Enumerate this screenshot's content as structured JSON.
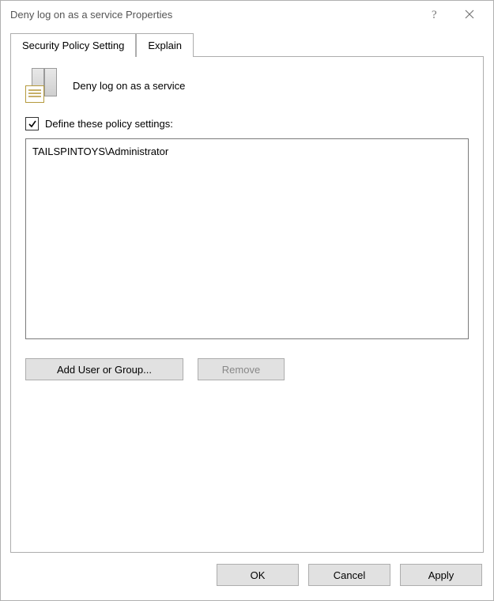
{
  "titlebar": {
    "title": "Deny log on as a service Properties"
  },
  "tabs": {
    "security": "Security Policy Setting",
    "explain": "Explain"
  },
  "panel": {
    "heading": "Deny log on as a service",
    "define_label": "Define these policy settings:",
    "define_checked": true,
    "items": [
      "TAILSPINTOYS\\Administrator"
    ],
    "add_button": "Add User or Group...",
    "remove_button": "Remove"
  },
  "footer": {
    "ok": "OK",
    "cancel": "Cancel",
    "apply": "Apply"
  }
}
